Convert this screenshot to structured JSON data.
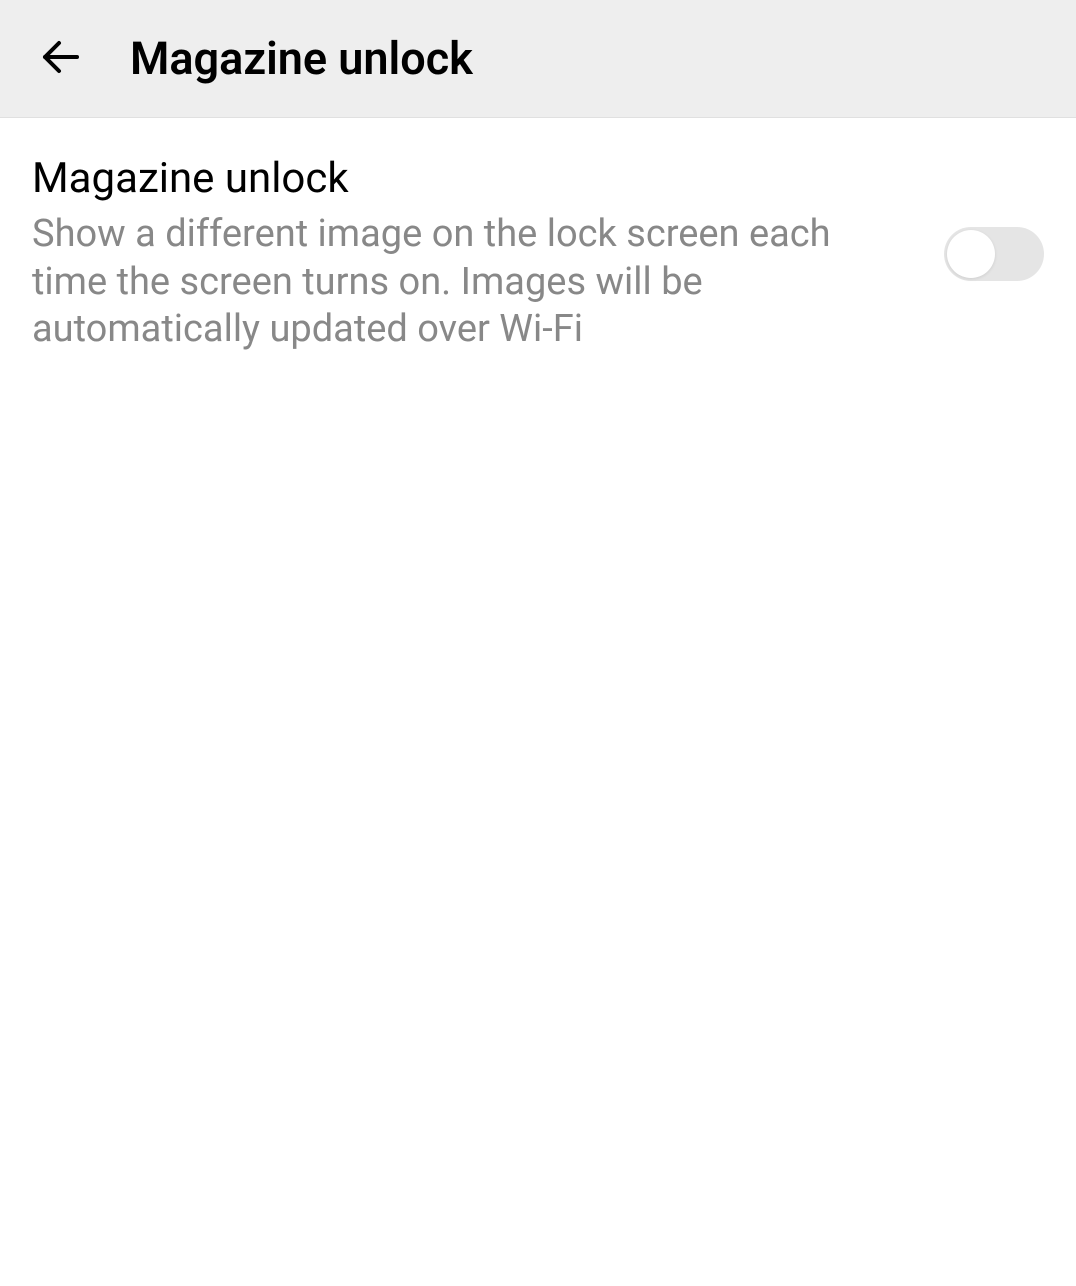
{
  "header": {
    "title": "Magazine unlock"
  },
  "settings": {
    "magazine_unlock": {
      "title": "Magazine unlock",
      "description": "Show a different image on the lock screen each time the screen turns on. Images will be automatically updated over Wi-Fi",
      "enabled": false
    }
  }
}
